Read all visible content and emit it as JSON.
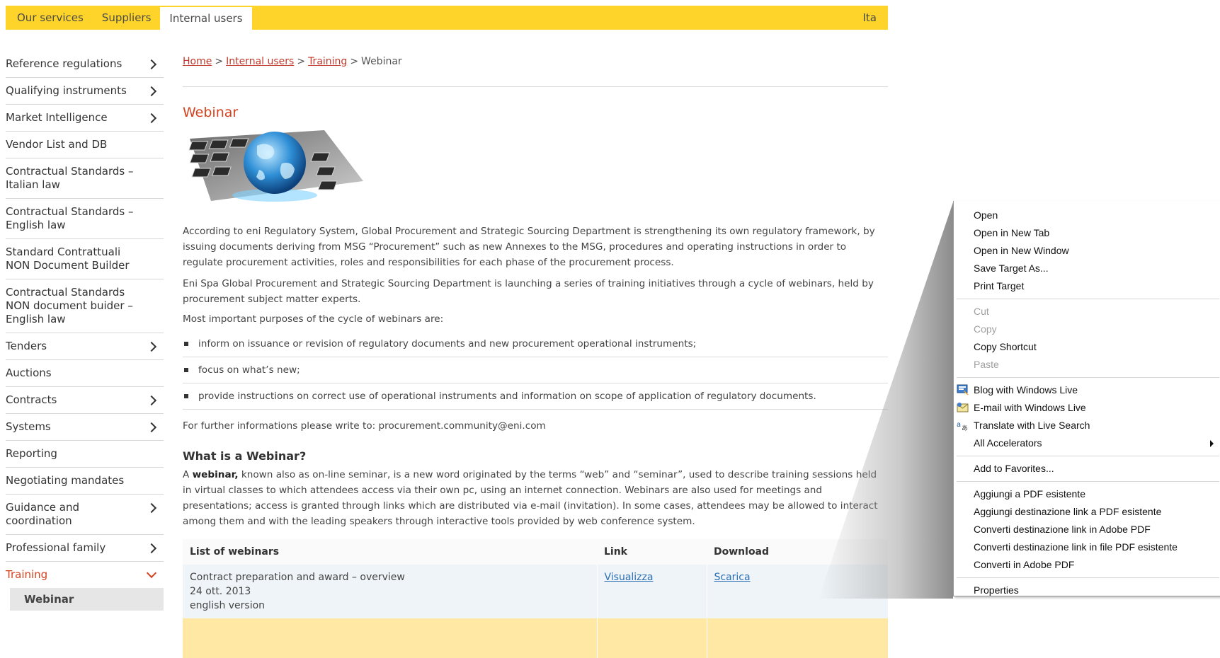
{
  "topbar": {
    "tabs": [
      "Our services",
      "Suppliers",
      "Internal users"
    ],
    "lang": "Ita"
  },
  "sidebar": {
    "items": [
      {
        "label": "Reference regulations",
        "chevron": true
      },
      {
        "label": "Qualifying instruments",
        "chevron": true
      },
      {
        "label": "Market Intelligence",
        "chevron": true
      },
      {
        "label": "Vendor List and DB",
        "chevron": false
      },
      {
        "label": "Contractual Standards – Italian law",
        "chevron": false
      },
      {
        "label": "Contractual Standards – English law",
        "chevron": false
      },
      {
        "label": "Standard Contrattuali NON Document Builder",
        "chevron": false
      },
      {
        "label": "Contractual Standards NON document buider – English law",
        "chevron": false
      },
      {
        "label": "Tenders",
        "chevron": true
      },
      {
        "label": "Auctions",
        "chevron": false
      },
      {
        "label": "Contracts",
        "chevron": true
      },
      {
        "label": "Systems",
        "chevron": true
      },
      {
        "label": "Reporting",
        "chevron": false
      },
      {
        "label": "Negotiating mandates",
        "chevron": false
      },
      {
        "label": "Guidance and coordination",
        "chevron": true
      },
      {
        "label": "Professional family",
        "chevron": true
      },
      {
        "label": "Training",
        "chevron": true
      }
    ],
    "sub_item": "Webinar"
  },
  "breadcrumb": {
    "home": "Home",
    "internal": "Internal users",
    "training": "Training",
    "current": "Webinar",
    "sep": ">"
  },
  "main": {
    "title": "Webinar",
    "p1": "According to eni Regulatory System, Global Procurement and Strategic Sourcing Department is strengthening its own regulatory framework, by issuing documents deriving from MSG “Procurement” such as new Annexes to the MSG, procedures and operating instructions  in order to regulate procurement activities, roles and responsibilities for each phase of the procurement process.",
    "p2": "Eni Spa Global Procurement and Strategic Sourcing Department is launching a series of training initiatives through a cycle of webinars, held by procurement subject matter experts.",
    "p3": "Most important purposes of the cycle of webinars are:",
    "bullets": [
      "inform on issuance or revision of regulatory documents and new procurement operational instruments;",
      "focus on what’s new;",
      "provide instructions on correct use of operational instruments and information on scope of application of regulatory documents."
    ],
    "contact": "For further informations please write to: procurement.community@eni.com",
    "h2": "What is a Webinar?",
    "p4_prefix": "A ",
    "p4_bold": "webinar,",
    "p4_rest": " known also as on-line seminar, is a new word originated by the terms “web” and “seminar”, used to describe training sessions held in virtual classes to which attendees access via their own pc, using an internet connection. Webinars are also used for meetings and presentations; access is granted through links which are distributed via e-mail (invitation). In some cases, attendees may be allowed to interact among them and with the leading speakers through interactive tools provided by web conference system."
  },
  "table": {
    "headers": [
      "List of webinars",
      "Link",
      "Download"
    ],
    "rows": [
      {
        "title": "Contract preparation and award – overview",
        "date": "24 ott. 2013",
        "version": "english version",
        "link": "Visualizza",
        "download": "Scarica"
      }
    ]
  },
  "context_menu": {
    "items": [
      {
        "label": "Open"
      },
      {
        "label": "Open in New Tab"
      },
      {
        "label": "Open in New Window"
      },
      {
        "label": "Save Target As..."
      },
      {
        "label": "Print Target"
      },
      {
        "sep": true
      },
      {
        "label": "Cut",
        "disabled": true
      },
      {
        "label": "Copy",
        "disabled": true
      },
      {
        "label": "Copy Shortcut"
      },
      {
        "label": "Paste",
        "disabled": true
      },
      {
        "sep": true
      },
      {
        "label": "Blog with Windows Live",
        "icon": "blog-icon"
      },
      {
        "label": "E-mail with Windows Live",
        "icon": "email-icon"
      },
      {
        "label": "Translate with Live Search",
        "icon": "translate-icon"
      },
      {
        "label": "All Accelerators",
        "submenu": true
      },
      {
        "sep": true
      },
      {
        "label": "Add to Favorites..."
      },
      {
        "sep": true
      },
      {
        "label": "Aggiungi a PDF esistente"
      },
      {
        "label": "Aggiungi destinazione link a PDF esistente"
      },
      {
        "label": "Converti destinazione link in Adobe PDF"
      },
      {
        "label": "Converti destinazione link in file PDF esistente"
      },
      {
        "label": "Converti in Adobe PDF"
      },
      {
        "sep": true
      },
      {
        "label": "Properties"
      }
    ]
  },
  "colors": {
    "accent_yellow": "#ffd42a",
    "title_red": "#d4421f",
    "link_red": "#c0392b",
    "link_blue": "#2a6fb3"
  }
}
